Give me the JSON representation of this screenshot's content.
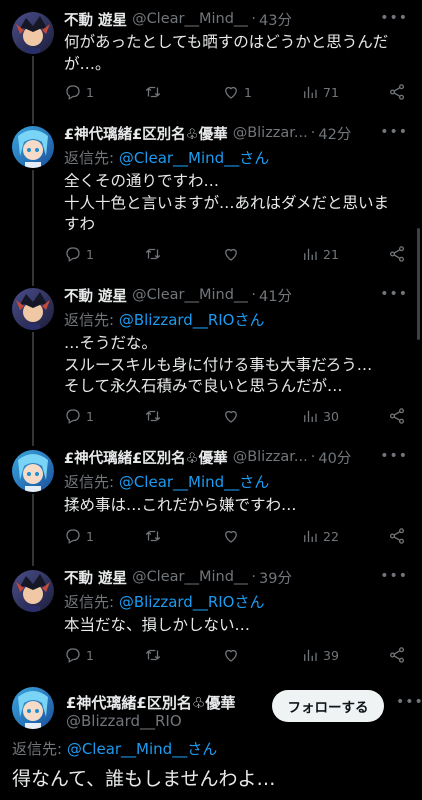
{
  "tweets": [
    {
      "name": "不動 遊星",
      "handle": "@Clear__Mind__",
      "time": "43分",
      "reply_prefix": "",
      "reply_mention": "",
      "reply_suffix": "",
      "body": [
        "何があったとしても晒すのはどうかと思うんだ",
        "が…。"
      ],
      "replies": "1",
      "retweets": "",
      "likes": "1",
      "views": "71"
    },
    {
      "name": "£神代璃緒£区別名♧優華",
      "handle": "@Blizzar...",
      "time": "42分",
      "reply_prefix": "返信先: ",
      "reply_mention": "@Clear__Mind__さん",
      "reply_suffix": "",
      "body": [
        "全くその通りですわ…",
        "十人十色と言いますが…あれはダメだと思いま",
        "すわ"
      ],
      "replies": "1",
      "retweets": "",
      "likes": "",
      "views": "21"
    },
    {
      "name": "不動 遊星",
      "handle": "@Clear__Mind__",
      "time": "41分",
      "reply_prefix": "返信先: ",
      "reply_mention": "@Blizzard__RIOさん",
      "reply_suffix": "",
      "body": [
        "…そうだな。",
        "スルースキルも身に付ける事も大事だろう…",
        "そして永久石積みで良いと思うんだが…"
      ],
      "replies": "1",
      "retweets": "",
      "likes": "",
      "views": "30"
    },
    {
      "name": "£神代璃緒£区別名♧優華",
      "handle": "@Blizzar...",
      "time": "40分",
      "reply_prefix": "返信先: ",
      "reply_mention": "@Clear__Mind__さん",
      "reply_suffix": "",
      "body": [
        "揉め事は…これだから嫌ですわ…"
      ],
      "replies": "1",
      "retweets": "",
      "likes": "",
      "views": "22"
    },
    {
      "name": "不動 遊星",
      "handle": "@Clear__Mind__",
      "time": "39分",
      "reply_prefix": "返信先: ",
      "reply_mention": "@Blizzard__RIOさん",
      "reply_suffix": "",
      "body": [
        "本当だな、損しかしない…"
      ],
      "replies": "1",
      "retweets": "",
      "likes": "",
      "views": "39"
    }
  ],
  "focused": {
    "name": "£神代璃緒£区別名♧優華",
    "handle": "@Blizzard__RIO",
    "follow_label": "フォローする",
    "reply_prefix": "返信先: ",
    "reply_mention": "@Clear__Mind__さん",
    "body": "得なんて、誰もしませんわよ…"
  },
  "icons": {
    "reply": "reply-icon",
    "retweet": "retweet-icon",
    "like": "like-icon",
    "views": "views-icon",
    "share": "share-icon",
    "more": "more-icon"
  },
  "colors": {
    "background": "#000000",
    "text": "#e7e9ea",
    "secondary": "#71767b",
    "mention": "#1d9bf0",
    "follow_bg": "#eff3f4"
  }
}
